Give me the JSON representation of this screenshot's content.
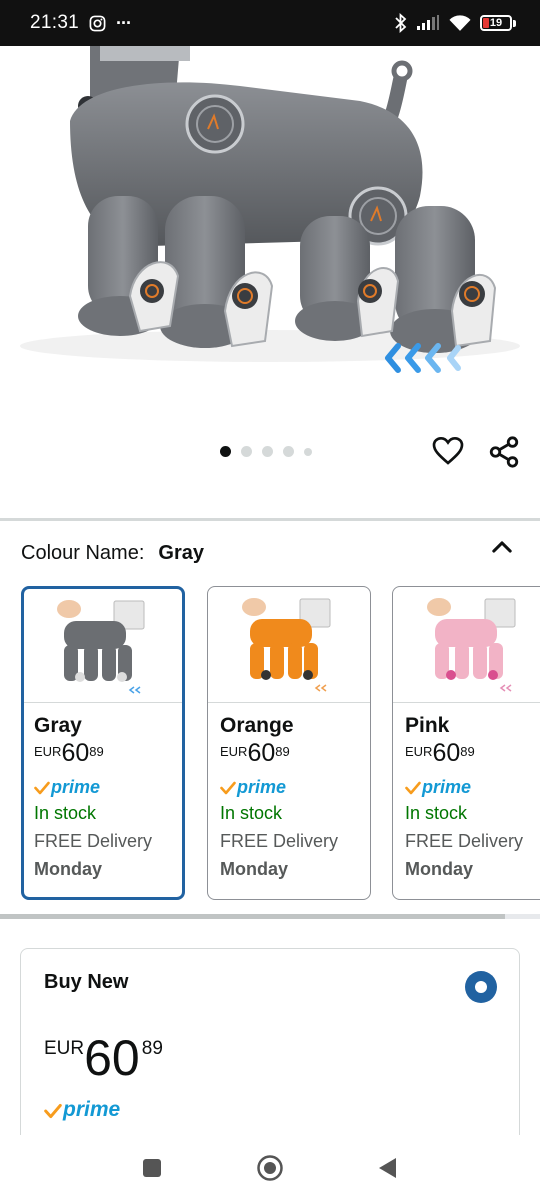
{
  "status_bar": {
    "time": "21:31",
    "overflow": "···",
    "battery": "19"
  },
  "gallery": {
    "image_count": 5,
    "active_index": 0
  },
  "colour": {
    "label": "Colour Name:",
    "value": "Gray"
  },
  "swatches": [
    {
      "name": "Gray",
      "currency": "EUR",
      "whole": "60",
      "fraction": "89",
      "prime": "prime",
      "stock": "In stock",
      "delivery": "FREE Delivery",
      "day": "Monday",
      "color": "#6b6e72",
      "selected": true
    },
    {
      "name": "Orange",
      "currency": "EUR",
      "whole": "60",
      "fraction": "89",
      "prime": "prime",
      "stock": "In stock",
      "delivery": "FREE Delivery",
      "day": "Monday",
      "color": "#f08a1c",
      "selected": false
    },
    {
      "name": "Pink",
      "currency": "EUR",
      "whole": "60",
      "fraction": "89",
      "prime": "prime",
      "stock": "In stock",
      "delivery": "FREE Delivery",
      "day": "Monday",
      "color": "#f2b3c6",
      "selected": false
    }
  ],
  "buy_new": {
    "title": "Buy New",
    "currency": "EUR",
    "whole": "60",
    "fraction": "89",
    "prime": "prime"
  },
  "colors": {
    "selected_border": "#2162a1",
    "prime_blue": "#1399d4",
    "prime_check": "#f79c1d",
    "in_stock": "#007600"
  }
}
